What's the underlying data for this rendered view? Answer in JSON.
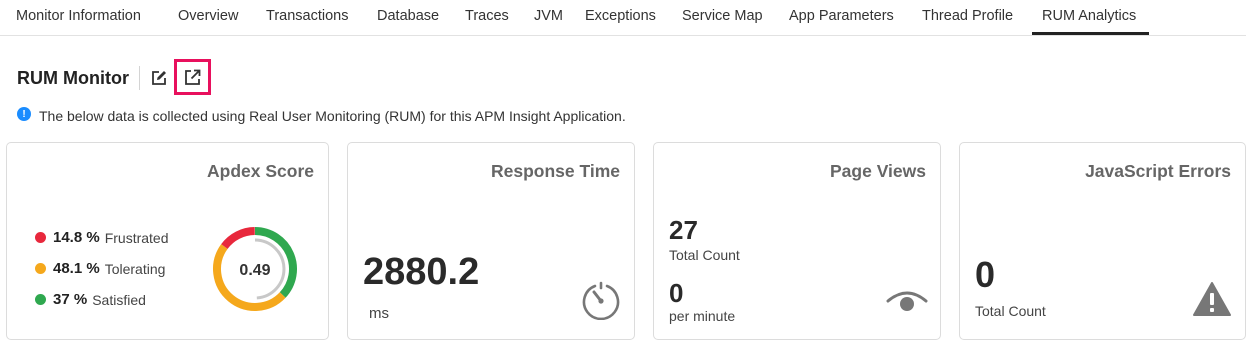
{
  "tabs": [
    {
      "label": "Monitor Information"
    },
    {
      "label": "Overview"
    },
    {
      "label": "Transactions"
    },
    {
      "label": "Database"
    },
    {
      "label": "Traces"
    },
    {
      "label": "JVM"
    },
    {
      "label": "Exceptions"
    },
    {
      "label": "Service Map"
    },
    {
      "label": "App Parameters"
    },
    {
      "label": "Thread Profile"
    },
    {
      "label": "RUM Analytics"
    }
  ],
  "active_tab": "RUM Analytics",
  "header": {
    "title": "RUM Monitor",
    "edit_icon": "edit-icon",
    "external_icon": "external-link-icon"
  },
  "info": {
    "icon": "info-icon",
    "icon_glyph": "!",
    "text": "The below data is collected using Real User Monitoring (RUM) for this APM Insight Application."
  },
  "apdex": {
    "title": "Apdex Score",
    "score": "0.49",
    "legend": [
      {
        "value": "14.8 %",
        "label": "Frustrated",
        "color": "#e8283c",
        "fraction": 0.148
      },
      {
        "value": "48.1 %",
        "label": "Tolerating",
        "color": "#f5a81c",
        "fraction": 0.481
      },
      {
        "value": "37 %",
        "label": "Satisfied",
        "color": "#2fa84f",
        "fraction": 0.37
      }
    ],
    "inner_ring_color": "#c8c8c8",
    "inner_ring_fraction": 0.49
  },
  "response_time": {
    "title": "Response Time",
    "value": "2880.2",
    "unit": "ms",
    "icon": "speedometer-icon"
  },
  "page_views": {
    "title": "Page Views",
    "total": "27",
    "total_label": "Total Count",
    "rate": "0",
    "rate_label": "per minute",
    "icon": "eye-icon"
  },
  "js_errors": {
    "title": "JavaScript Errors",
    "value": "0",
    "label": "Total Count",
    "icon": "warning-icon"
  },
  "colors": {
    "highlight_border": "#e8105d",
    "info_blue": "#1a8cff",
    "icon_gray": "#777777"
  }
}
